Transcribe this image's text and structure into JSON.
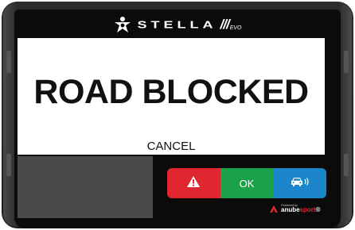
{
  "brand": {
    "name": "STELLA",
    "edition": "///",
    "edition_sub": "EVO"
  },
  "message": {
    "headline": "ROAD BLOCKED",
    "cancel_label": "CANCEL"
  },
  "actions": {
    "alert_icon": "warning-triangle-icon",
    "ok_label": "OK",
    "car_icon": "car-signal-icon"
  },
  "footer": {
    "powered_by": "Powered by",
    "vendor_prefix": "anube",
    "vendor_suffix": "sport",
    "vendor_reg": "®"
  },
  "colors": {
    "alert": "#e0262f",
    "ok": "#1aa24a",
    "car": "#1b86c9",
    "frame": "#1e1e1e"
  }
}
